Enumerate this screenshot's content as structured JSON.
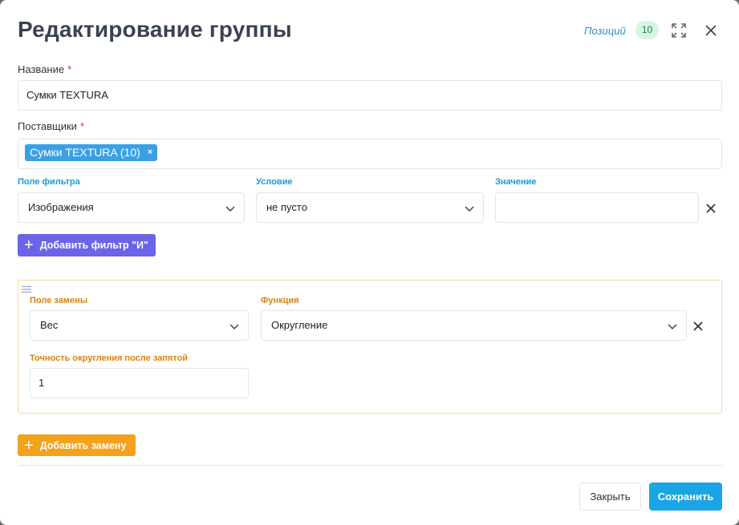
{
  "header": {
    "title": "Редактирование группы",
    "positions_label": "Позиций",
    "positions_count": "10"
  },
  "name_field": {
    "label": "Название",
    "required_mark": "*",
    "value": "Сумки TEXTURA"
  },
  "suppliers_field": {
    "label": "Поставщики",
    "required_mark": "*",
    "tags": [
      {
        "label": "Сумки TEXTURA (10)",
        "remove": "×"
      }
    ]
  },
  "filter": {
    "field_label": "Поле фильтра",
    "field_value": "Изображения",
    "condition_label": "Условие",
    "condition_value": "не пусто",
    "value_label": "Значение",
    "value_value": "",
    "add_button": "Добавить фильтр \"И\""
  },
  "replacement": {
    "field_label": "Поле замены",
    "field_value": "Вес",
    "function_label": "Функция",
    "function_value": "Округление",
    "precision_label": "Точность округления после запятой",
    "precision_value": "1",
    "add_button": "Добавить замену"
  },
  "footer": {
    "close_button": "Закрыть",
    "save_button": "Сохранить"
  },
  "colors": {
    "primary": "#1aa6e6",
    "purple": "#6b63e8",
    "orange": "#f4a21c",
    "tag": "#3aa0e6",
    "badge_bg": "#d7f5e6"
  }
}
